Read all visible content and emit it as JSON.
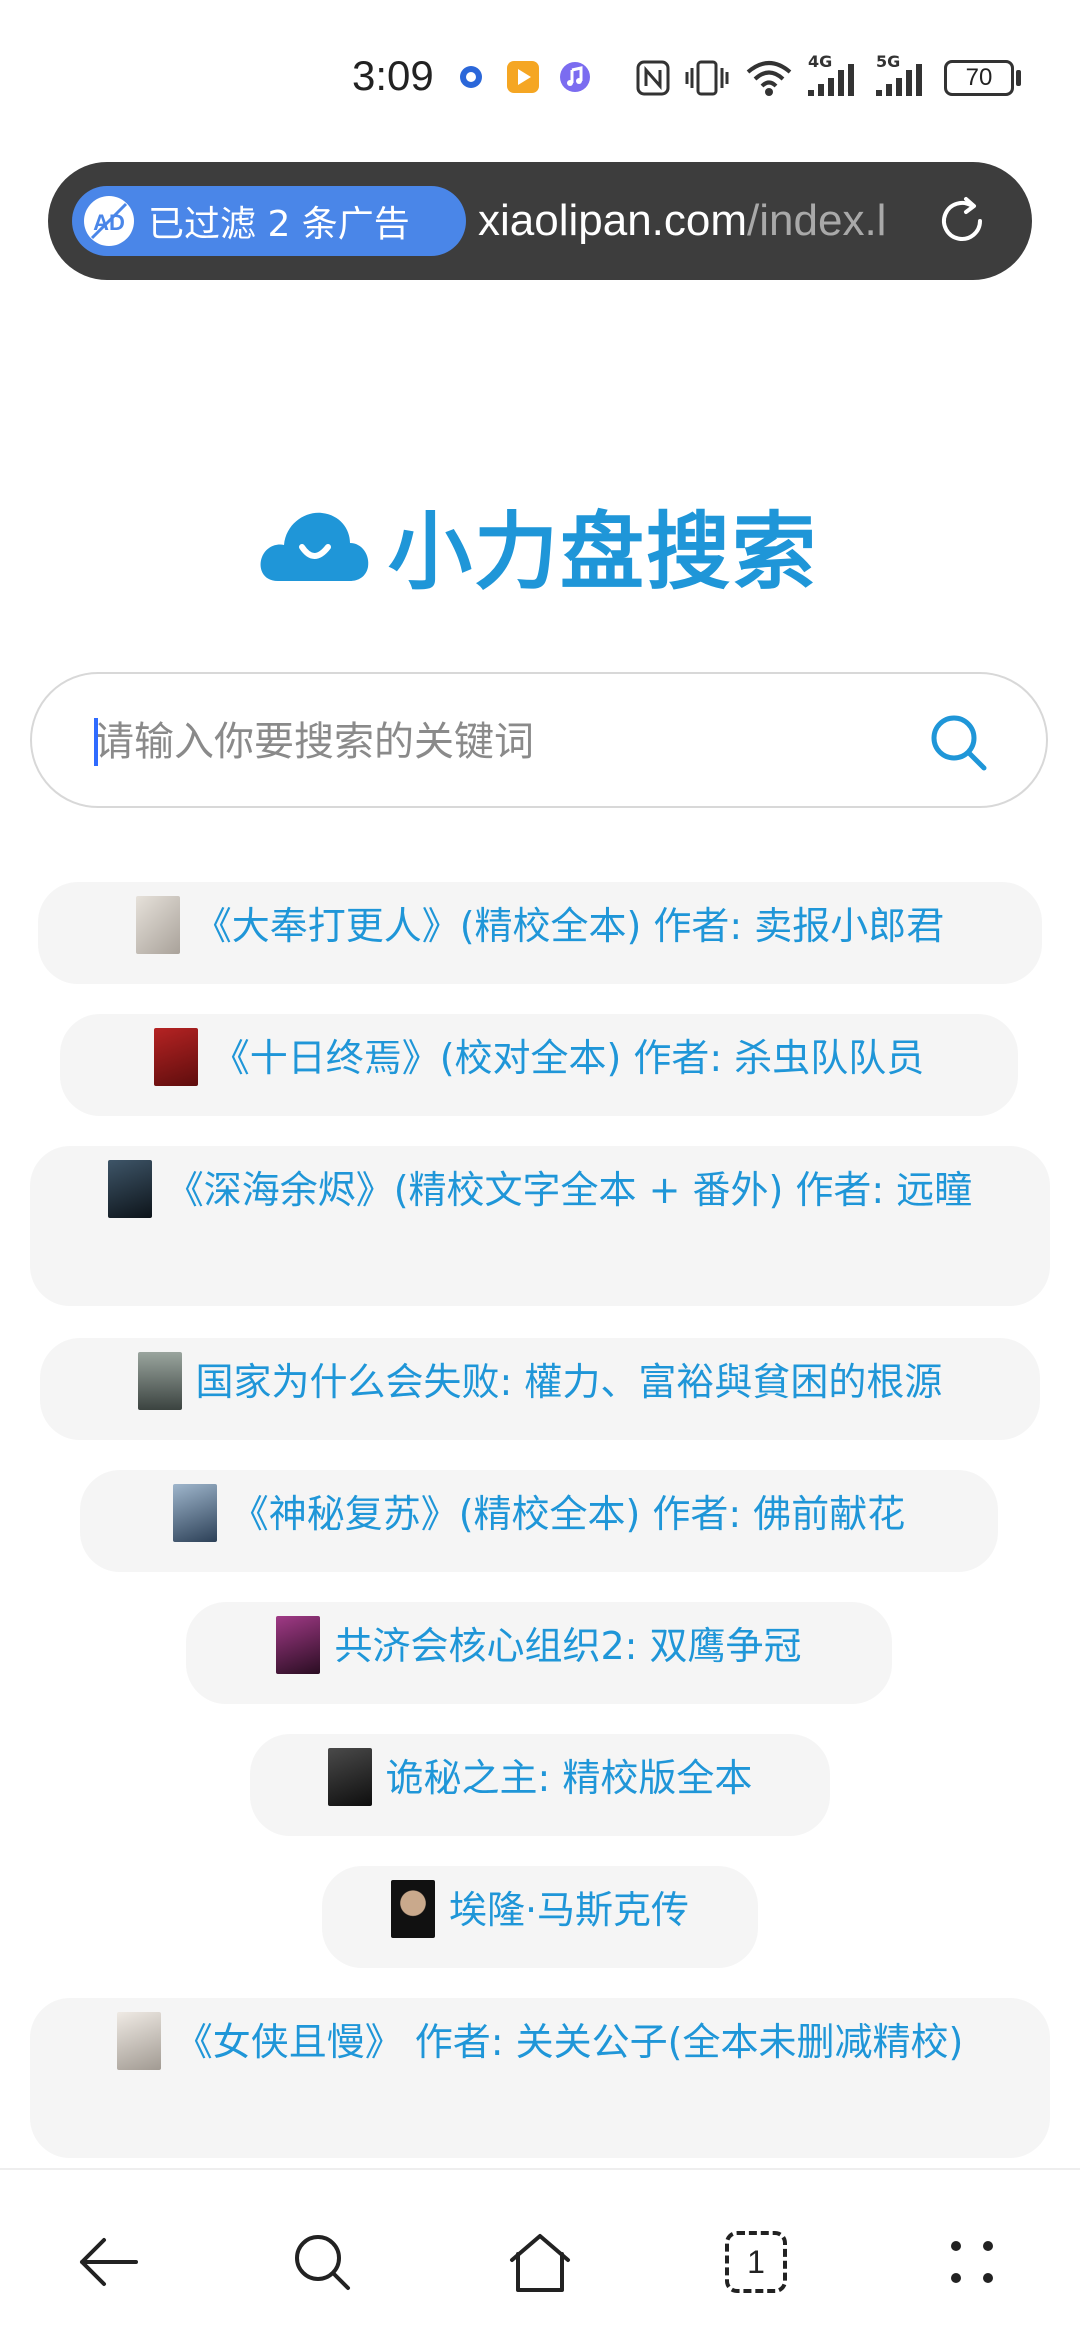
{
  "status_bar": {
    "time": "3:09",
    "network_4g": "4G",
    "network_5g": "5G",
    "battery": "70",
    "icons": [
      "notification-dot-icon",
      "video-app-icon",
      "music-app-icon",
      "nfc-icon",
      "vibrate-icon",
      "wifi-icon",
      "signal-4g-icon",
      "signal-5g-icon",
      "battery-icon"
    ]
  },
  "address_bar": {
    "ad_filter_label": "已过滤 2 条广告",
    "url_domain": "xiaolipan.com",
    "url_path": "/index.l"
  },
  "logo": {
    "text": "小力盘搜索"
  },
  "search": {
    "placeholder": "请输入你要搜索的关键词"
  },
  "books": [
    {
      "title": "《大奉打更人》(精校全本) 作者: 卖报小郎君",
      "cover_color": "#c9c2b8"
    },
    {
      "title": "《十日终焉》(校对全本) 作者: 杀虫队队员",
      "cover_color": "#8e1b1b"
    },
    {
      "title": "《深海余烬》(精校文字全本 + 番外) 作者: 远瞳",
      "cover_color": "#1d2a34"
    },
    {
      "title": "国家为什么会失败: 權力、富裕與貧困的根源",
      "cover_color": "#6e7a72"
    },
    {
      "title": "《神秘复苏》(精校全本) 作者: 佛前献花",
      "cover_color": "#4f6d8f"
    },
    {
      "title": "共济会核心组织2: 双鹰争冠",
      "cover_color": "#5a1e4a"
    },
    {
      "title": "诡秘之主: 精校版全本",
      "cover_color": "#2b2b2b"
    },
    {
      "title": "埃隆·马斯克传",
      "cover_color": "#1a1a1a"
    },
    {
      "title": "《女侠且慢》 作者: 关关公子(全本未删减精校)",
      "cover_color": "#d9d4cf"
    }
  ],
  "bottom_nav": {
    "tab_count": "1",
    "icons": [
      "back-icon",
      "search-icon",
      "home-icon",
      "tabs-icon",
      "more-icon"
    ]
  },
  "colors": {
    "accent": "#1f96d8",
    "ad_pill": "#4a86e8",
    "address_bar_bg": "#3d3d3d",
    "item_bg": "#f5f5f5"
  }
}
